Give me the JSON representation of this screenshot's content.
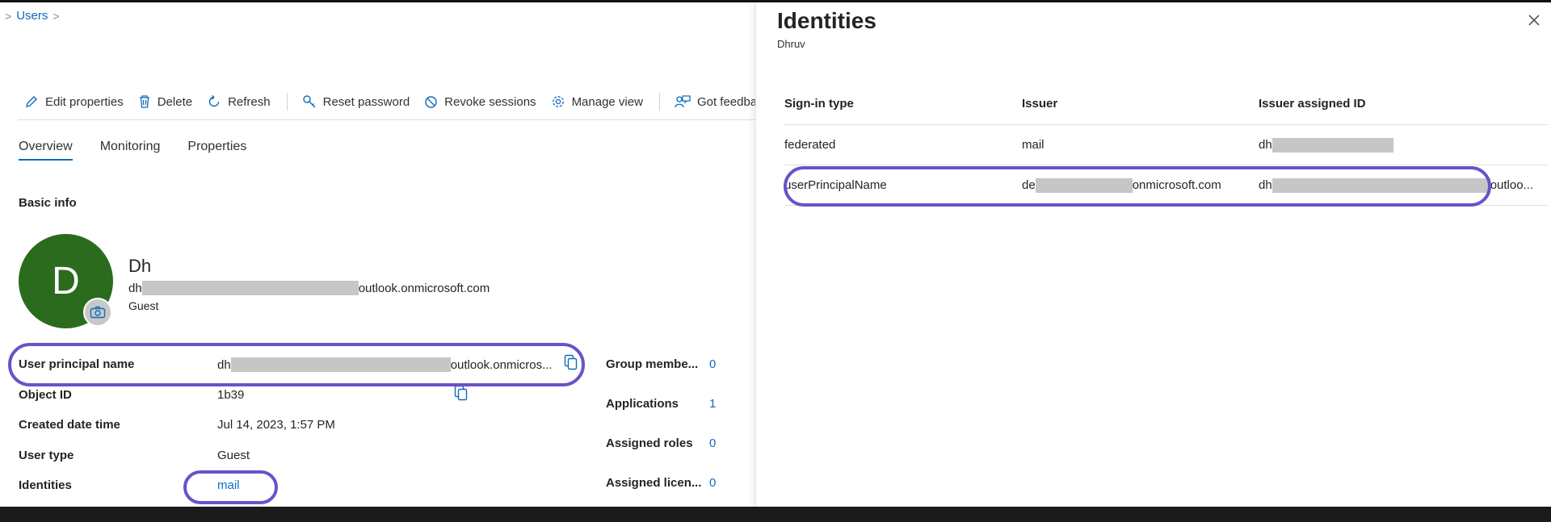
{
  "breadcrumb": {
    "link": "Users"
  },
  "toolbar": {
    "edit": "Edit properties",
    "delete": "Delete",
    "refresh": "Refresh",
    "reset_password": "Reset password",
    "revoke_sessions": "Revoke sessions",
    "manage_view": "Manage view",
    "feedback": "Got feedback"
  },
  "tabs": [
    "Overview",
    "Monitoring",
    "Properties"
  ],
  "basic_info": {
    "title": "Basic info",
    "avatar_letter": "D",
    "name": "Dh",
    "email_prefix": "dh",
    "email_suffix": "outlook.onmicrosoft.com",
    "role": "Guest"
  },
  "properties": {
    "upn_label": "User principal name",
    "upn_prefix": "dh",
    "upn_suffix": "outlook.onmicros...",
    "object_id_label": "Object ID",
    "object_id_value": "1b39",
    "created_label": "Created date time",
    "created_value": "Jul 14, 2023, 1:57 PM",
    "user_type_label": "User type",
    "user_type_value": "Guest",
    "identities_label": "Identities",
    "identities_value": "mail"
  },
  "summary": {
    "group_label": "Group membe...",
    "group_value": "0",
    "apps_label": "Applications",
    "apps_value": "1",
    "roles_label": "Assigned roles",
    "roles_value": "0",
    "licenses_label": "Assigned licen...",
    "licenses_value": "0"
  },
  "panel": {
    "title": "Identities",
    "subtitle": "Dhruv",
    "headers": {
      "signin": "Sign-in type",
      "issuer": "Issuer",
      "assigned_id": "Issuer assigned ID"
    },
    "rows": [
      {
        "signin": "federated",
        "issuer_prefix": "mail",
        "issuer_suffix": "",
        "id_prefix": "dh",
        "id_suffix": ""
      },
      {
        "signin": "userPrincipalName",
        "issuer_prefix": "de",
        "issuer_suffix": "onmicrosoft.com",
        "id_prefix": "dh",
        "id_suffix": "outloo..."
      }
    ]
  },
  "colors": {
    "accent": "#0f6cbd",
    "highlight": "#6a52c8",
    "avatar": "#2b6b1e"
  }
}
